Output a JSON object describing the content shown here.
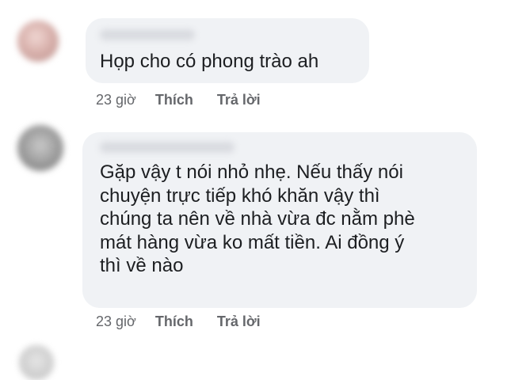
{
  "comments": [
    {
      "text": "Họp cho có phong trào ah",
      "time": "23 giờ",
      "like_label": "Thích",
      "reply_label": "Trả lời"
    },
    {
      "text": "Gặp vậy t nói nhỏ nhẹ. Nếu thấy nói\nchuyện trực tiếp khó khăn vậy thì\nchúng ta nên về nhà vừa đc nằm phè\nmát hàng vừa ko mất tiền. Ai đồng ý\nthì về nào",
      "time": "23 giờ",
      "like_label": "Thích",
      "reply_label": "Trả lời"
    }
  ]
}
